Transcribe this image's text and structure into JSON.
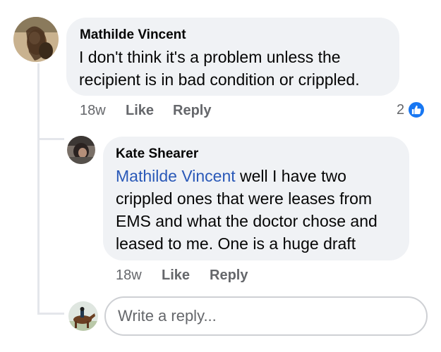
{
  "comment": {
    "author": "Mathilde Vincent",
    "text_line1": "I don't think it's a problem unless the",
    "text_line2": "recipient is in bad condition or crippled.",
    "time": "18w",
    "like_label": "Like",
    "reply_label": "Reply",
    "reaction_count": "2",
    "reaction_icon": "thumbs-up-icon"
  },
  "reply": {
    "author": "Kate Shearer",
    "mention": "Mathilde Vincent",
    "text_after_mention": " well I have two",
    "text_line2": "crippled ones that were leases from",
    "text_line3": "EMS and what the doctor chose and",
    "text_line4": "leased to me. One is a huge draft",
    "time": "18w",
    "like_label": "Like",
    "reply_label": "Reply"
  },
  "composer": {
    "placeholder": "Write a reply..."
  },
  "colors": {
    "bubble": "#f0f2f5",
    "mention": "#2a59b8",
    "meta": "#65676b",
    "like_blue": "#1877f2",
    "thread_line": "#e4e6eb"
  }
}
